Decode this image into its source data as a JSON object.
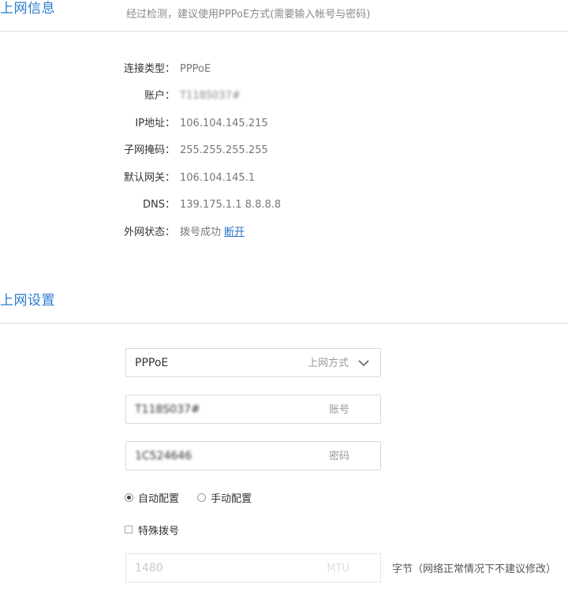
{
  "info_section": {
    "title": "上网信息",
    "subtitle": "经过检测，建议使用PPPoE方式(需要输入帐号与密码)",
    "rows": [
      {
        "label": "连接类型：",
        "value": "PPPoE"
      },
      {
        "label": "账户：",
        "value": "T118S037#"
      },
      {
        "label": "IP地址：",
        "value": "106.104.145.215"
      },
      {
        "label": "子网掩码：",
        "value": "255.255.255.255"
      },
      {
        "label": "默认网关：",
        "value": "106.104.145.1"
      },
      {
        "label": "DNS：",
        "value": "139.175.1.1 8.8.8.8"
      },
      {
        "label": "外网状态：",
        "value": "拨号成功",
        "link": "断开"
      }
    ]
  },
  "settings_section": {
    "title": "上网设置",
    "mode_select": {
      "value": "PPPoE",
      "suffix": "上网方式"
    },
    "account_field": {
      "value": "T118S037#",
      "suffix": "账号"
    },
    "password_field": {
      "value": "1C524646",
      "suffix": "密码"
    },
    "config_radios": [
      {
        "label": "自动配置",
        "checked": true
      },
      {
        "label": "手动配置",
        "checked": false
      }
    ],
    "special_dial": {
      "label": "特殊拨号",
      "checked": false
    },
    "mtu_field": {
      "value": "1480",
      "suffix": "MTU"
    },
    "mtu_note": "字节（网络正常情况下不建议修改）"
  }
}
